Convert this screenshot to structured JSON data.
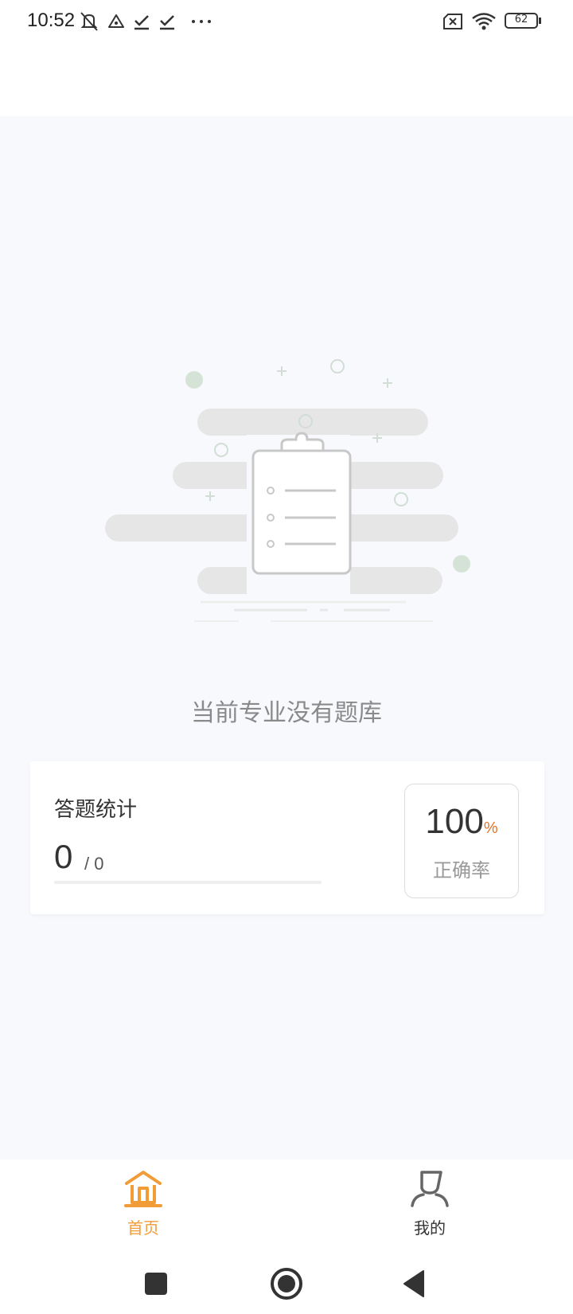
{
  "status_bar": {
    "time": "10:52",
    "battery": "62",
    "icons": [
      "mute-icon",
      "alert-icon",
      "check-icon",
      "check-icon",
      "more-icon",
      "sim-off-icon",
      "wifi-icon",
      "battery-icon"
    ]
  },
  "empty_state": {
    "illustration": "empty-clipboard-illustration",
    "message": "当前专业没有题库"
  },
  "stats": {
    "title": "答题统计",
    "answered": "0",
    "total": "/ 0",
    "progress": 0,
    "rate_value": "100",
    "rate_unit": "%",
    "rate_label": "正确率"
  },
  "tabs": [
    {
      "label": "首页",
      "icon": "home-icon",
      "active": true
    },
    {
      "label": "我的",
      "icon": "user-icon",
      "active": false
    }
  ],
  "colors": {
    "accent": "#f29c38",
    "rate_unit": "#e8732a",
    "background": "#f7f9fd"
  }
}
